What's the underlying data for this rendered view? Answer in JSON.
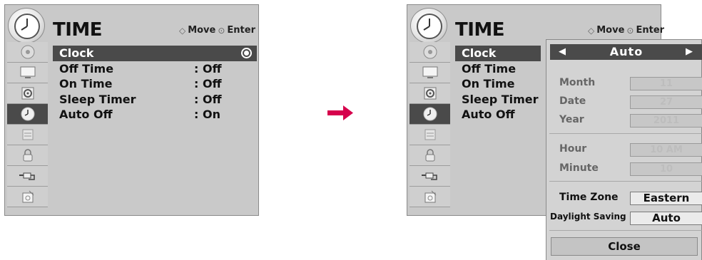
{
  "left_menu": {
    "title": "TIME",
    "hint_move": "Move",
    "hint_enter": "Enter",
    "items": [
      {
        "label": "Clock",
        "value": ""
      },
      {
        "label": "Off Time",
        "value": ": Off"
      },
      {
        "label": "On Time",
        "value": ": Off"
      },
      {
        "label": "Sleep Timer",
        "value": ": Off"
      },
      {
        "label": "Auto Off",
        "value": ": On"
      }
    ],
    "selected_item": "Clock"
  },
  "right_menu": {
    "title": "TIME",
    "hint_move": "Move",
    "hint_enter": "Enter",
    "items": [
      {
        "label": "Clock"
      },
      {
        "label": "Off Time"
      },
      {
        "label": "On Time"
      },
      {
        "label": "Sleep Timer"
      },
      {
        "label": "Auto Off"
      }
    ]
  },
  "sidebar_icons": [
    "disc-icon",
    "monitor-icon",
    "speaker-icon",
    "clock-icon",
    "lock-icon",
    "padlock-icon",
    "input-cable-icon",
    "support-icon"
  ],
  "active_icon": "clock-icon",
  "clock_popup": {
    "mode": "Auto",
    "fields": [
      {
        "label": "Month",
        "value": "11"
      },
      {
        "label": "Date",
        "value": "27"
      },
      {
        "label": "Year",
        "value": "2011"
      },
      {
        "label": "Hour",
        "value": "10 AM"
      },
      {
        "label": "Minute",
        "value": "10"
      }
    ],
    "time_zone_label": "Time Zone",
    "time_zone_value": "Eastern",
    "daylight_label": "Daylight Saving",
    "daylight_value": "Auto",
    "close_label": "Close"
  },
  "colors": {
    "panel_bg": "#c9c9c9",
    "highlight": "#4a4a4a",
    "arrow": "#d6004c"
  }
}
